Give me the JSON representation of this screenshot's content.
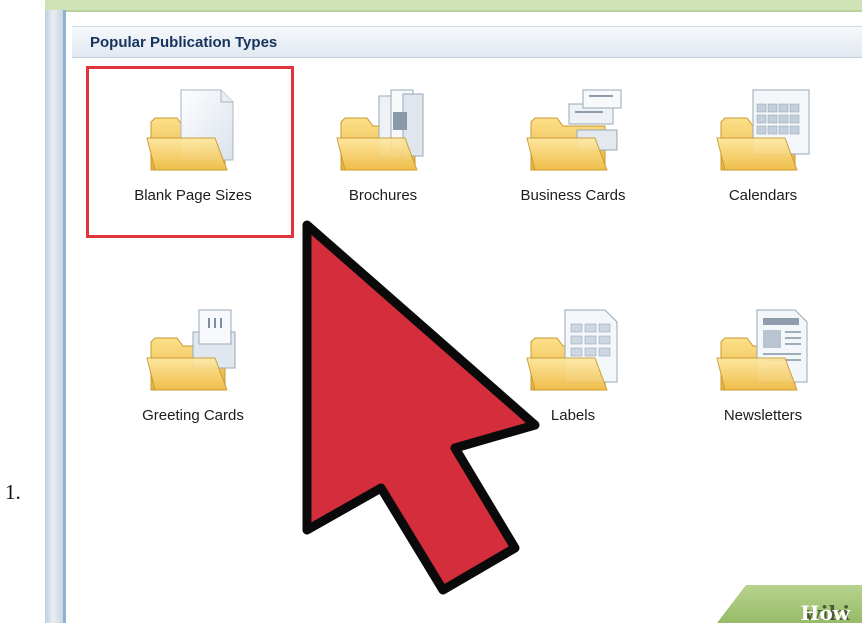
{
  "list_number": "1.",
  "section": {
    "title": "Popular Publication Types"
  },
  "tiles": [
    {
      "label": "Blank Page Sizes",
      "icon": "blank-page-folder-icon",
      "selected": true
    },
    {
      "label": "Brochures",
      "icon": "brochure-folder-icon",
      "selected": false
    },
    {
      "label": "Business Cards",
      "icon": "business-cards-folder-icon",
      "selected": false
    },
    {
      "label": "Calendars",
      "icon": "calendar-folder-icon",
      "selected": false
    },
    {
      "label": "Greeting Cards",
      "icon": "greeting-card-folder-icon",
      "selected": false
    },
    {
      "label": "Labels",
      "icon": "labels-folder-icon",
      "selected": false
    },
    {
      "label": "Newsletters",
      "icon": "newsletter-folder-icon",
      "selected": false
    }
  ],
  "watermark": {
    "wiki": "wiki",
    "how": "How"
  },
  "colors": {
    "highlight_red": "#e0353b",
    "arrow_red": "#d42d3c",
    "header_text": "#15335c",
    "folder_yellow": "#f1c54e"
  }
}
